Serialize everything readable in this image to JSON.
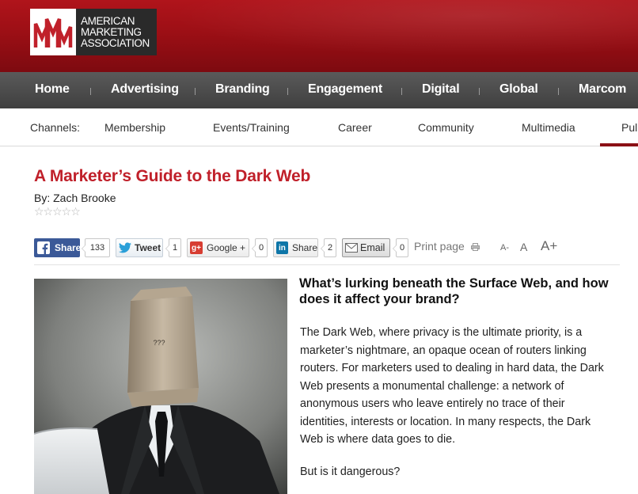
{
  "logo": {
    "lines": [
      "American",
      "Marketing",
      "Association"
    ],
    "brand_color": "#b0141b"
  },
  "main_nav": {
    "items": [
      "Home",
      "Advertising",
      "Branding",
      "Engagement",
      "Digital",
      "Global",
      "Marcom"
    ]
  },
  "channels": {
    "label": "Channels:",
    "items": [
      "Membership",
      "Events/Training",
      "Career",
      "Community",
      "Multimedia",
      "Pul"
    ],
    "active_color": "#8b1016"
  },
  "article": {
    "title": "A Marketer’s Guide to the Dark Web",
    "byline": "By: Zach Brooke",
    "rating_stars": "☆☆☆☆☆",
    "title_color": "#c0202a",
    "subhead": "What’s lurking beneath the Surface Web, and how does it affect your brand?",
    "paragraph1": "The Dark Web, where privacy is the ultimate priority, is a marketer’s nightmare, an opaque ocean of routers linking routers. For marketers used to dealing in hard data, the Dark Web presents a monumental challenge: a network of anonymous users who leave entirely no trace of their identities, interests or location. In many respects, the Dark Web is where data goes to die.",
    "paragraph2": "But is it dangerous?",
    "image_mark": "???"
  },
  "share": {
    "facebook": {
      "label": "Share",
      "count": "133",
      "color": "#3b5998"
    },
    "twitter": {
      "label": "Tweet",
      "count": "1"
    },
    "google": {
      "label": "Google +",
      "count": "0",
      "icon_text": "g+"
    },
    "linkedin": {
      "label": "Share",
      "count": "2",
      "icon_text": "in"
    },
    "email": {
      "label": "Email",
      "count": "0"
    },
    "print_label": "Print page",
    "font_small": "A-",
    "font_normal": "A",
    "font_large": "A+"
  },
  "icons": [
    "facebook-icon",
    "twitter-bird-icon",
    "google-plus-icon",
    "linkedin-icon",
    "email-envelope-icon",
    "printer-icon"
  ]
}
